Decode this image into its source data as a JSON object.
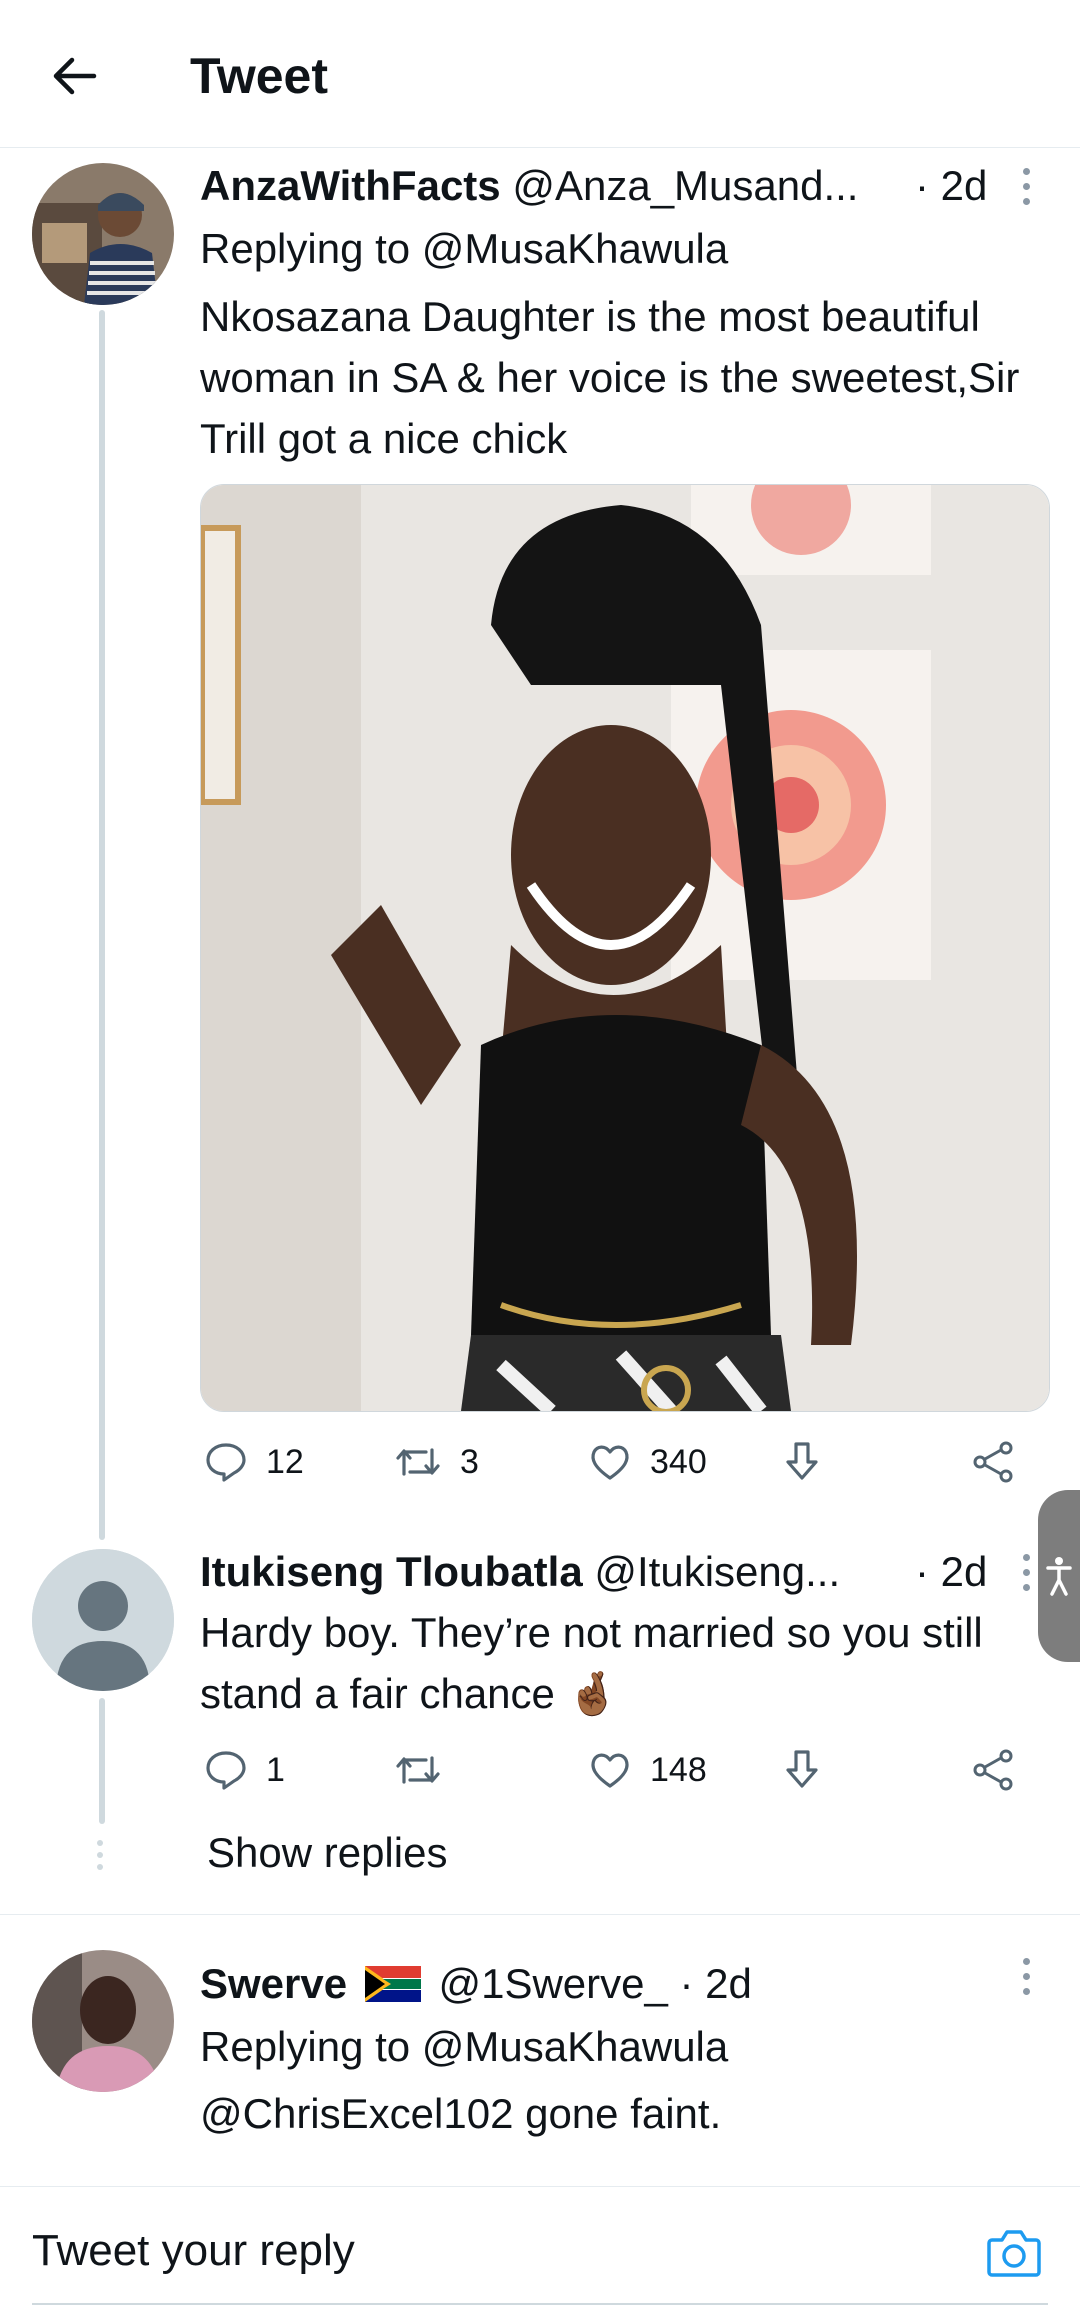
{
  "header": {
    "title": "Tweet"
  },
  "tweets": [
    {
      "display_name": "AnzaWithFacts",
      "handle": "@Anza_Musand...",
      "time": "· 2d",
      "replying_to": "Replying to @MusaKhawula",
      "text": "Nkosazana Daughter is the most beautiful woman in SA & her voice is the sweetest,Sir Trill got a nice chick",
      "replies": "12",
      "retweets": "3",
      "likes": "340"
    },
    {
      "display_name": "Itukiseng Tloubatla",
      "handle": "@Itukiseng...",
      "time": "· 2d",
      "text": "Hardy boy. They’re not married so you still stand a fair chance 🤞🏾",
      "replies": "1",
      "retweets": "",
      "likes": "148"
    },
    {
      "display_name": "Swerve",
      "handle": "@1Swerve_",
      "time": "· 2d",
      "replying_to": "Replying to @MusaKhawula",
      "text": "@ChrisExcel102 gone faint."
    }
  ],
  "show_replies": "Show replies",
  "reply_bar": {
    "placeholder": "Tweet your reply"
  },
  "colors": {
    "accent": "#1d9bf0",
    "line": "#cfd9de"
  }
}
